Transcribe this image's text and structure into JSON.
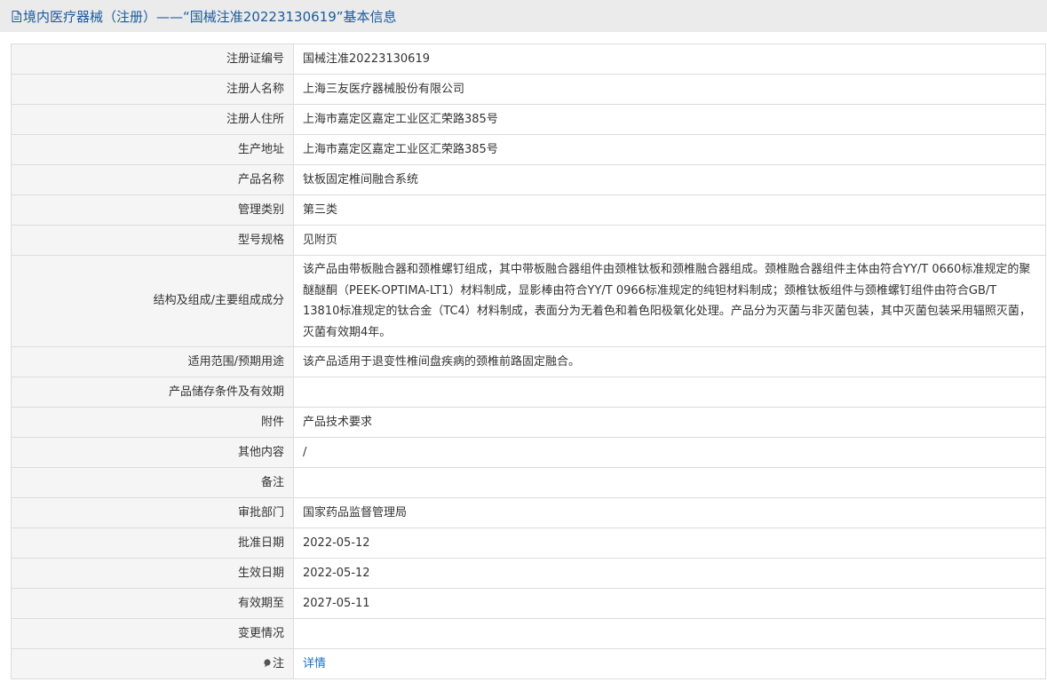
{
  "header": {
    "title": "境内医疗器械（注册）——“国械注准20223130619”基本信息"
  },
  "rows": [
    {
      "label": "注册证编号",
      "value": "国械注准20223130619"
    },
    {
      "label": "注册人名称",
      "value": "上海三友医疗器械股份有限公司"
    },
    {
      "label": "注册人住所",
      "value": "上海市嘉定区嘉定工业区汇荣路385号"
    },
    {
      "label": "生产地址",
      "value": "上海市嘉定区嘉定工业区汇荣路385号"
    },
    {
      "label": "产品名称",
      "value": "钛板固定椎间融合系统"
    },
    {
      "label": "管理类别",
      "value": "第三类"
    },
    {
      "label": "型号规格",
      "value": "见附页"
    },
    {
      "label": "结构及组成/主要组成成分",
      "value": "该产品由带板融合器和颈椎螺钉组成，其中带板融合器组件由颈椎钛板和颈椎融合器组成。颈椎融合器组件主体由符合YY/T 0660标准规定的聚醚醚酮（PEEK-OPTIMA-LT1）材料制成，显影棒由符合YY/T 0966标准规定的纯钽材料制成；颈椎钛板组件与颈椎螺钉组件由符合GB/T 13810标准规定的钛合金（TC4）材料制成，表面分为无着色和着色阳极氧化处理。产品分为灭菌与非灭菌包装，其中灭菌包装采用辐照灭菌，灭菌有效期4年。"
    },
    {
      "label": "适用范围/预期用途",
      "value": "该产品适用于退变性椎间盘疾病的颈椎前路固定融合。"
    },
    {
      "label": "产品储存条件及有效期",
      "value": ""
    },
    {
      "label": "附件",
      "value": "产品技术要求"
    },
    {
      "label": "其他内容",
      "value": "/"
    },
    {
      "label": "备注",
      "value": ""
    },
    {
      "label": "审批部门",
      "value": "国家药品监督管理局"
    },
    {
      "label": "批准日期",
      "value": "2022-05-12"
    },
    {
      "label": "生效日期",
      "value": "2022-05-12"
    },
    {
      "label": "有效期至",
      "value": "2027-05-11"
    },
    {
      "label": "变更情况",
      "value": ""
    }
  ],
  "note": {
    "label": "注",
    "link": "详情",
    "icon": "pin-icon"
  },
  "colors": {
    "title": "#1a5a9e",
    "link": "#1a6fc4",
    "label_bg": "#f5f5f5",
    "border": "#dcdcdc"
  }
}
